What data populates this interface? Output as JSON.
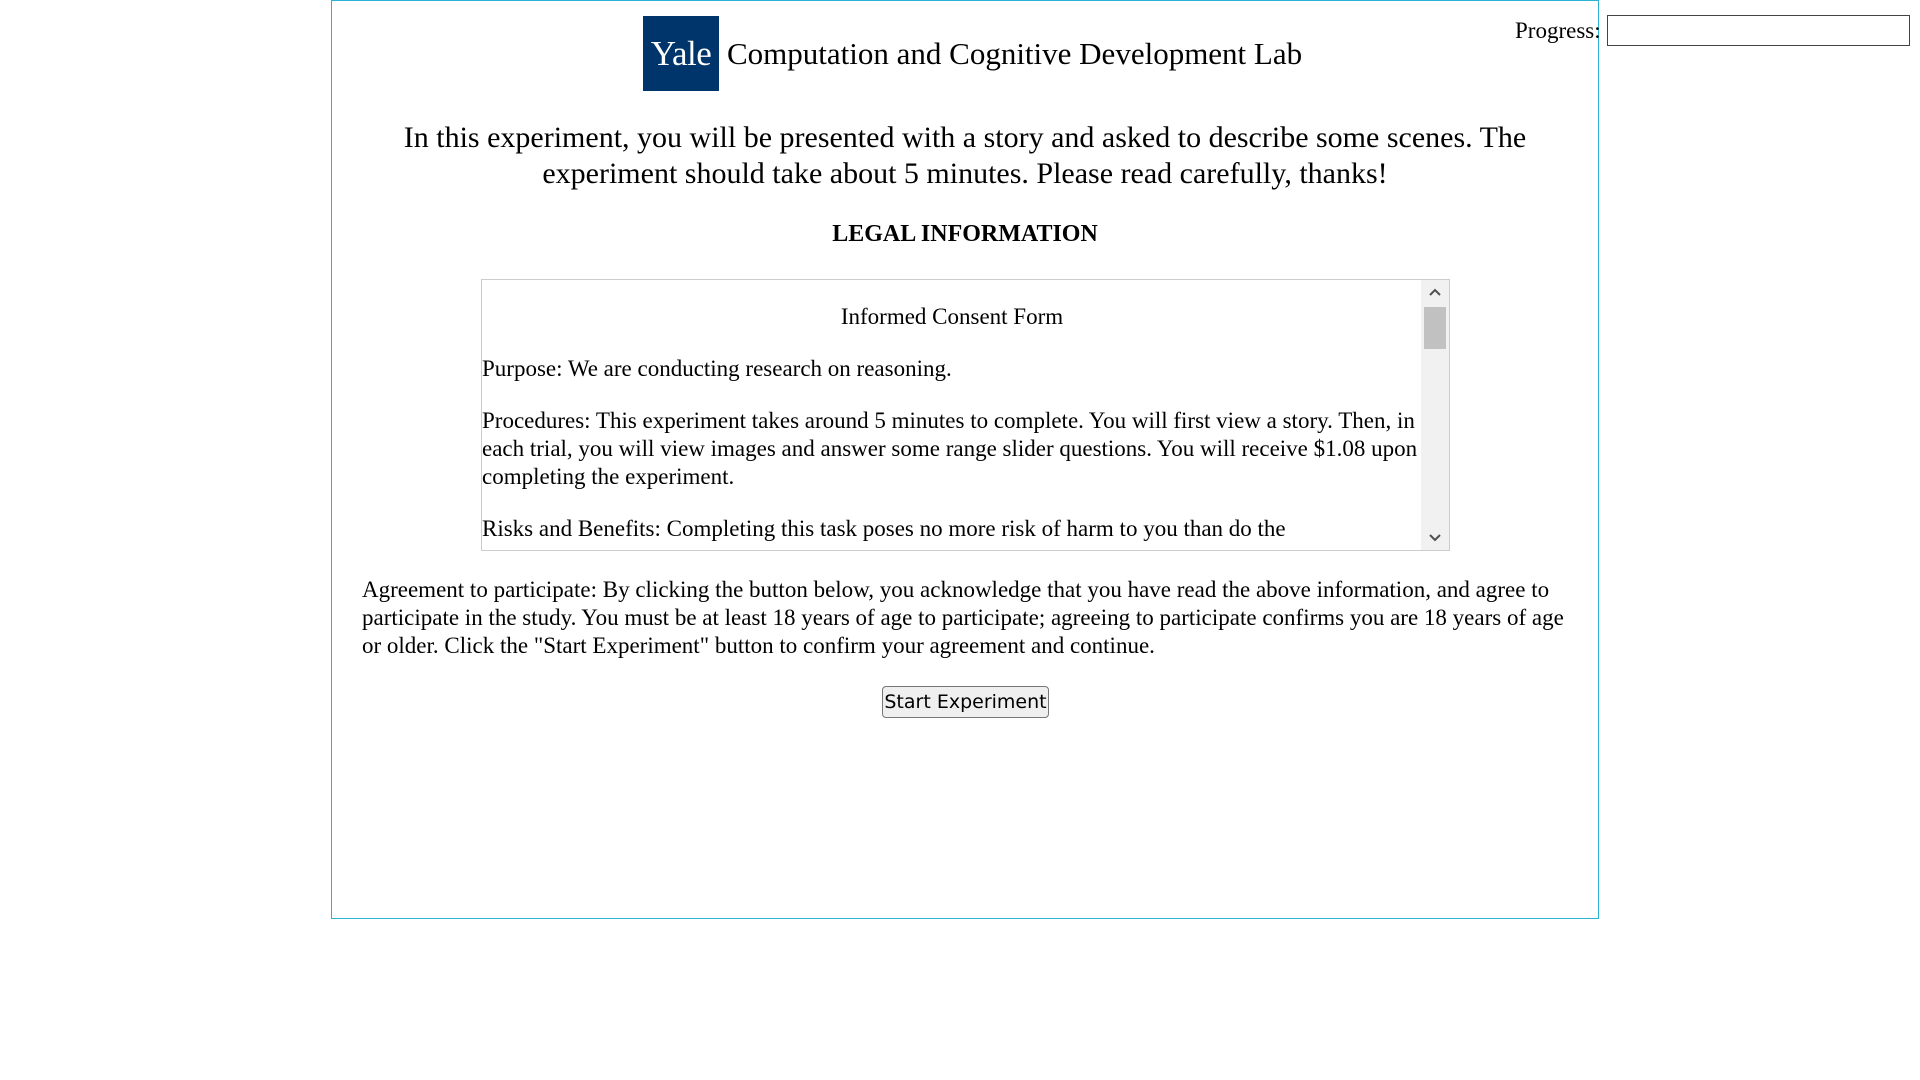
{
  "progress": {
    "label": "Progress:",
    "value": 0
  },
  "header": {
    "logo_text": "Yale",
    "lab_name": "Computation and Cognitive Development Lab"
  },
  "intro_text": "In this experiment, you will be presented with a story and asked to describe some scenes. The experiment should take about 5 minutes. Please read carefully, thanks!",
  "legal_heading": "LEGAL INFORMATION",
  "consent": {
    "title": "Informed Consent Form",
    "paragraphs": [
      "Purpose: We are conducting research on reasoning.",
      "Procedures: This experiment takes around 5 minutes to complete. You will first view a story. Then, in each trial, you will view images and answer some range slider questions. You will receive $1.08 upon completing the experiment.",
      "Risks and Benefits: Completing this task poses no more risk of harm to you than do the"
    ]
  },
  "agreement_text": "Agreement to participate: By clicking the button below, you acknowledge that you have read the above information, and agree to participate in the study. You must be at least 18 years of age to participate; agreeing to participate confirms you are 18 years of age or older. Click the \"Start Experiment\" button to confirm your agreement and continue.",
  "start_button_label": "Start Experiment",
  "colors": {
    "frame_border": "#2ab3d2",
    "yale_blue": "#00356b"
  },
  "icons": {
    "scroll_up": "chevron-up-icon",
    "scroll_down": "chevron-down-icon"
  }
}
